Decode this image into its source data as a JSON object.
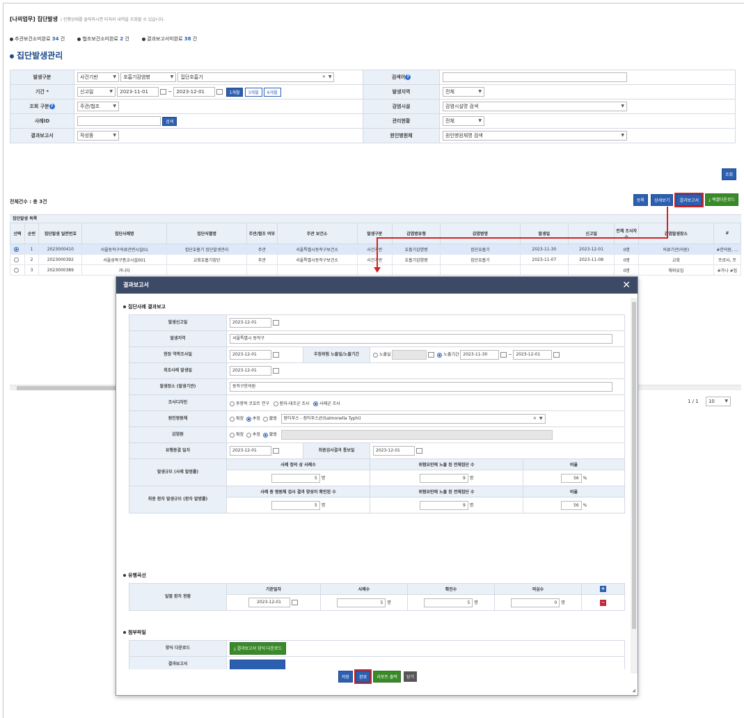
{
  "header": {
    "title": "[나의업무] 집단발생",
    "subtitle": "/ 진행상태를 클릭하시면 미처리 내역을 조회할 수 있습니다."
  },
  "stats": [
    {
      "label": "추관보건소미완료",
      "count": "34",
      "unit": "건"
    },
    {
      "label": "협조보건소미완료",
      "count": "2",
      "unit": "건"
    },
    {
      "label": "결과보고서미완료",
      "count": "38",
      "unit": "건"
    }
  ],
  "section_title": "집단발생관리",
  "search": {
    "occur_type_label": "발생구분",
    "occur_type_1": "사건기반",
    "occur_type_2": "호흡기감염병",
    "occur_type_3": "집단호흡기",
    "keyword_label": "검색어",
    "period_label": "기간 *",
    "period_type": "신고일",
    "date_from": "2023-11-01",
    "date_to": "2023-12-01",
    "btn_1m": "1개월",
    "btn_3m": "3개월",
    "btn_6m": "6개월",
    "region_label": "발생지역",
    "region_value": "전체",
    "view_type_label": "조회 구분",
    "view_type_value": "주관/협조",
    "facility_label": "감염시설",
    "facility_value": "감염시설명 검색",
    "case_id_label": "사례ID",
    "case_search_btn": "검색",
    "mgmt_label": "관리현황",
    "mgmt_value": "전체",
    "report_label": "결과보고서",
    "report_value": "작성중",
    "pathogen_label": "원인병원체",
    "pathogen_value": "원인병원체명 검색",
    "lookup_btn": "조회"
  },
  "list": {
    "total_text": "전체건수 : 총 3건",
    "buttons": {
      "register": "등록",
      "detail": "상세보기",
      "report": "결과보고서",
      "excel": "엑셀다운로드"
    },
    "title": "집단발생 목록",
    "columns": [
      "선택",
      "순번",
      "집단발생 일련번호",
      "집단사례명",
      "집단식별명",
      "주관/협조 여부",
      "주관 보건소",
      "발생구분",
      "감염병유형",
      "감염병명",
      "발생일",
      "신고일",
      "전체 조사자수",
      "감염발생장소",
      "#"
    ],
    "rows": [
      [
        "",
        "1",
        "2023000410",
        "서울동작구의료관련시설01",
        "집단호흡기 집단발생관리",
        "주관",
        "서울특별시동작구보건소",
        "사건기반",
        "호흡기감염병",
        "집단호흡기",
        "2023-11-30",
        "2023-12-01",
        "0명",
        "의료기관(의원)",
        "#한의원, ..."
      ],
      [
        "",
        "2",
        "2023000392",
        "서울성북구종교시설001",
        "교회호흡기집단",
        "주관",
        "서울특별시동작구보건소",
        "사건기반",
        "호흡기감염병",
        "집단호흡기",
        "2023-11-07",
        "2023-11-08",
        "0명",
        "교회",
        "프로사, 프"
      ],
      [
        "",
        "3",
        "2023000389",
        "가나다",
        "",
        "",
        "",
        "",
        "",
        "",
        "",
        "",
        "0명",
        "해외유입",
        "#가나 #집"
      ]
    ],
    "pager": "1 / 1",
    "page_size": "10"
  },
  "modal": {
    "title": "결과보고서",
    "sec1": "집단사례 결과보고",
    "report_date_label": "발생신고일",
    "report_date": "2023-12-01",
    "region_label": "발생지역",
    "region": "서울특별시 동작구",
    "field_survey_label": "현장 역학조사일",
    "field_survey_date": "2023-12-01",
    "exposure_label": "추정위험 노출일/노출기간",
    "exposure_day": "노출일",
    "exposure_period": "노출기간",
    "exposure_from": "2023-11-30",
    "exposure_to": "2023-12-01",
    "first_case_label": "최초사례 발생일",
    "first_case_date": "2023-12-01",
    "place_label": "발생장소 (발생기관)",
    "place": "동작구한의원",
    "design_label": "조사디자인",
    "design_1": "후향적 코호트 연구",
    "design_2": "환자-대조군 조사",
    "design_3": "사례군 조사",
    "pathogen_label": "원인병원체",
    "opt_confirmed": "확정",
    "opt_estimated": "추정",
    "opt_unknown": "불명",
    "pathogen_value": "장티푸스 - 장티푸스균(Salmonella Typhi)",
    "source_label": "감염원",
    "end_date_label": "유행종결 일자",
    "end_date": "2023-12-01",
    "final_result_label": "최종검사결과 통보일",
    "final_result_date": "2023-12-01",
    "scale_label": "발생규모 (사례 발병률)",
    "scale_h1": "사례 정의 상 사례수",
    "scale_h2": "위험요인에 노출 된 전체집단 수",
    "scale_h3": "비율",
    "scale_v1": "5",
    "scale_v2": "9",
    "scale_v3": "56",
    "final_scale_label": "최종 환자 발생규모 (환자 발병률)",
    "final_h1": "사례 중 병원체 검사 결과 양성이 확인된 수",
    "final_h2": "위험요인에 노출 된 전체집단 수",
    "final_h3": "비율",
    "final_v1": "5",
    "final_v2": "9",
    "final_v3": "56",
    "unit_person": "명",
    "unit_pct": "%",
    "sec2": "유행곡선",
    "curve_label": "일별 환자 현황",
    "curve_h1": "기준일자",
    "curve_h2": "사례수",
    "curve_h3": "확진수",
    "curve_h4": "의심수",
    "curve_date": "2023-12-01",
    "curve_cases": "5",
    "curve_confirmed": "5",
    "curve_suspected": "0",
    "sec3": "첨부파일",
    "form_dl_label": "양식 다운로드",
    "form_dl_btn": "결과보고서 양식 다운로드",
    "report_file_label": "결과보고서",
    "btn_save": "저장",
    "btn_complete": "완료",
    "btn_print": "리포트 출력",
    "btn_close": "닫기"
  },
  "colors": {
    "primary": "#2d5fb0",
    "green": "#3a8a2a",
    "header_bg": "#3c4a66",
    "highlight": "#d62020"
  }
}
